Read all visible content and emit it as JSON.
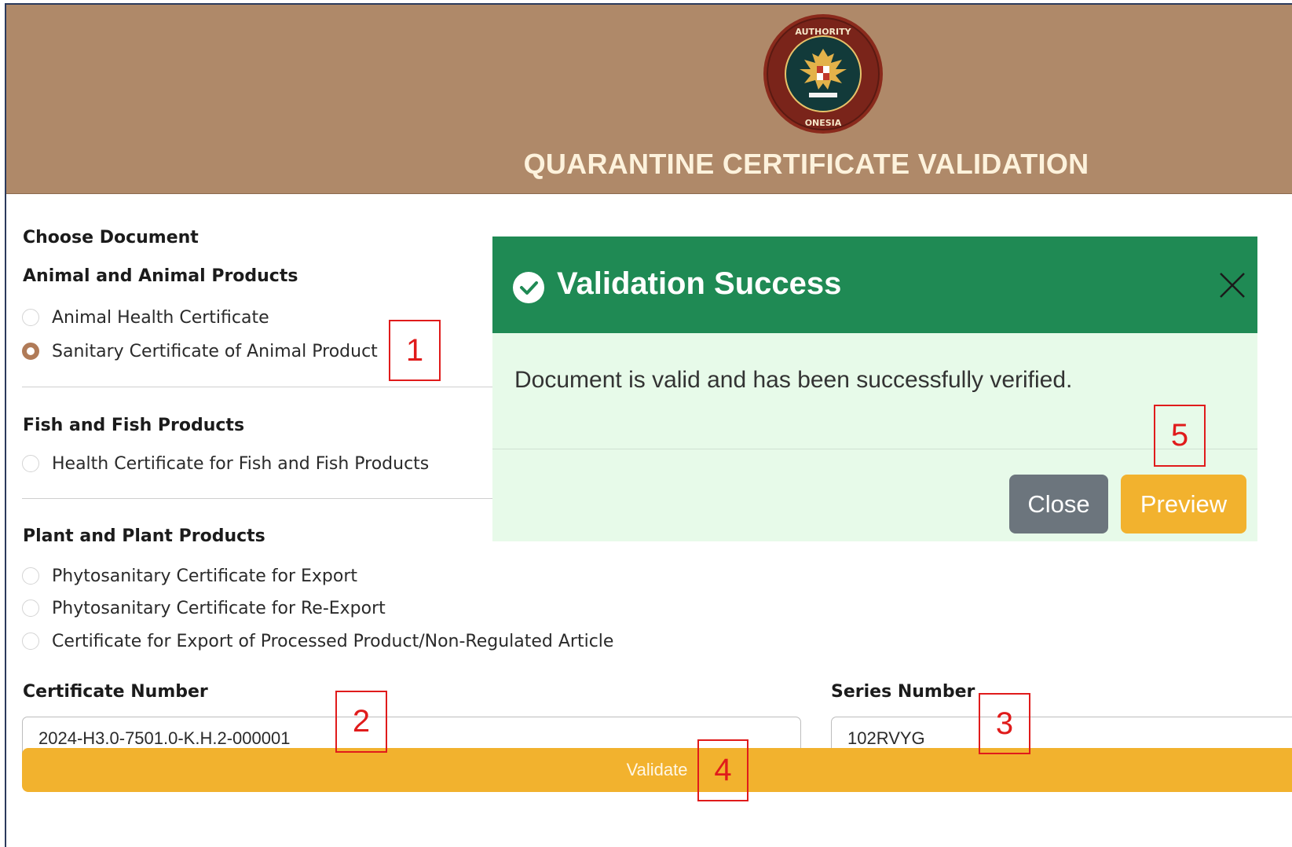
{
  "header": {
    "title": "QUARANTINE CERTIFICATE VALIDATION",
    "logo_text_top": "QUARANTINE AUTHORITY",
    "logo_text_bottom": "INDONESIAN"
  },
  "form": {
    "choose_document_label": "Choose Document",
    "groups": [
      {
        "title": "Animal and Animal Products",
        "options": [
          {
            "label": "Animal Health Certificate",
            "checked": false
          },
          {
            "label": "Sanitary Certificate of Animal Product",
            "checked": true
          }
        ]
      },
      {
        "title": "Fish and Fish Products",
        "options": [
          {
            "label": "Health Certificate for Fish and Fish Products",
            "checked": false
          }
        ]
      },
      {
        "title": "Plant and Plant Products",
        "options": [
          {
            "label": "Phytosanitary Certificate for Export",
            "checked": false
          },
          {
            "label": "Phytosanitary Certificate for Re-Export",
            "checked": false
          },
          {
            "label": "Certificate for Export of Processed Product/Non-Regulated Article",
            "checked": false
          }
        ]
      }
    ],
    "certificate_number_label": "Certificate Number",
    "certificate_number_value": "2024-H3.0-7501.0-K.H.2-000001",
    "series_number_label": "Series Number",
    "series_number_value": "102RVYG",
    "validate_label": "Validate"
  },
  "modal": {
    "title": "Validation Success",
    "message": "Document is valid and has been successfully verified.",
    "close_label": "Close",
    "preview_label": "Preview"
  },
  "annotations": [
    "1",
    "2",
    "3",
    "4",
    "5"
  ],
  "colors": {
    "header_bg": "#af8969",
    "accent": "#f2b22e",
    "modal_header": "#1f8a54",
    "modal_body": "#e7fae9",
    "annotation": "#e01b1b"
  }
}
